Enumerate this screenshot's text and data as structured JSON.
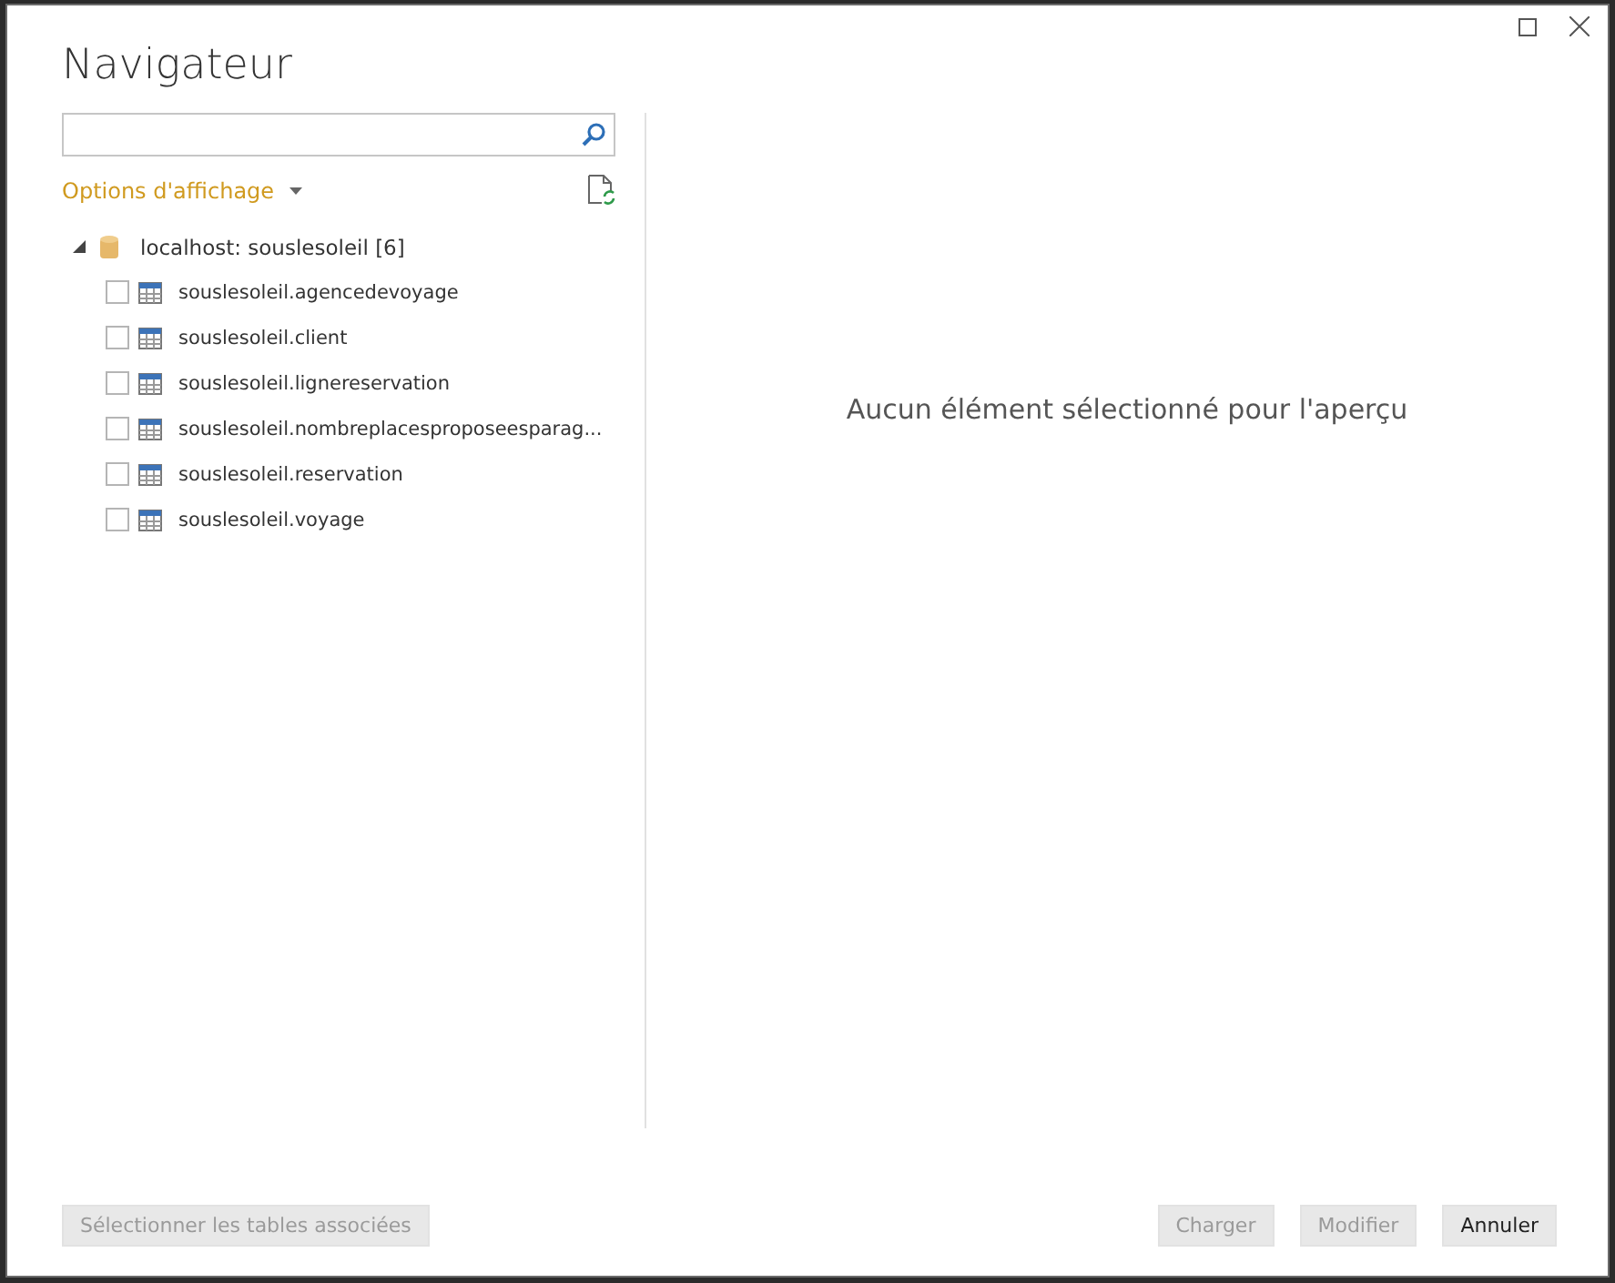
{
  "window": {
    "title": "Navigateur"
  },
  "display_options": {
    "label": "Options d'affichage"
  },
  "tree": {
    "label": "localhost: souslesoleil [6]",
    "expanded": true,
    "children": [
      {
        "label": "souslesoleil.agencedevoyage",
        "checked": false
      },
      {
        "label": "souslesoleil.client",
        "checked": false
      },
      {
        "label": "souslesoleil.lignereservation",
        "checked": false
      },
      {
        "label": "souslesoleil.nombreplacesproposeesparag...",
        "checked": false
      },
      {
        "label": "souslesoleil.reservation",
        "checked": false
      },
      {
        "label": "souslesoleil.voyage",
        "checked": false
      }
    ]
  },
  "preview": {
    "message": "Aucun élément sélectionné pour l'aperçu"
  },
  "left_buttons": [
    {
      "label": "Sélectionner les tables associées",
      "disabled": true
    }
  ],
  "right_buttons": [
    {
      "label": "Charger",
      "disabled": true
    },
    {
      "label": "Modifier",
      "disabled": true
    },
    {
      "label": "Annuler",
      "disabled": false
    }
  ]
}
